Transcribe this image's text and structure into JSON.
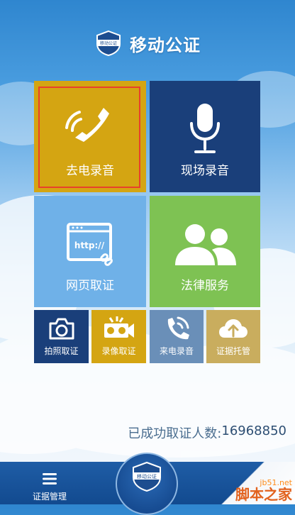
{
  "app": {
    "title": "移动公证",
    "badge_text": "移动公证"
  },
  "tiles": {
    "call_record": {
      "label": "去电录音",
      "icon": "phone-call-icon",
      "color": "#d4a512"
    },
    "live_record": {
      "label": "现场录音",
      "icon": "microphone-icon",
      "color": "#1a3f7a"
    },
    "web_evidence": {
      "label": "网页取证",
      "icon": "browser-link-icon",
      "icon_text": "http://",
      "color": "#6fb1e8"
    },
    "legal_service": {
      "label": "法律服务",
      "icon": "users-icon",
      "color": "#7ec253"
    },
    "photo_evidence": {
      "label": "拍照取证",
      "icon": "camera-icon",
      "color": "#1a3f7a"
    },
    "video_evidence": {
      "label": "录像取证",
      "icon": "video-camera-icon",
      "color": "#d4a512"
    },
    "incoming_call_record": {
      "label": "来电录音",
      "icon": "incoming-call-icon",
      "color": "#6a8fb8"
    },
    "evidence_custody": {
      "label": "证据托管",
      "icon": "cloud-upload-icon",
      "color": "#c9ad5e"
    }
  },
  "stats": {
    "label": "已成功取证人数:",
    "count": "16968850"
  },
  "tabbar": {
    "evidence_management": {
      "label": "证据管理",
      "icon": "menu-icon"
    },
    "center": {
      "icon": "notary-badge-icon",
      "badge_text": "移动公证"
    }
  },
  "watermark": {
    "line1": "jb51.net",
    "line2": "脚本之家"
  }
}
